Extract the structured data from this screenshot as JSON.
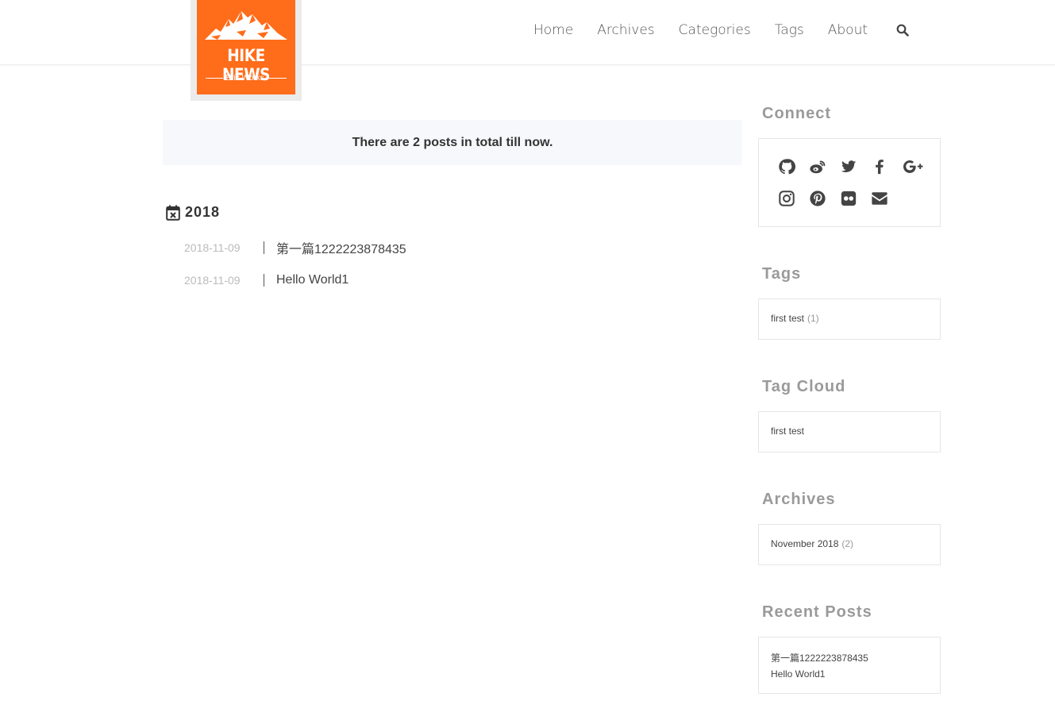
{
  "logo": {
    "title": "HIKE NEWS",
    "subtitle": "Eric Works."
  },
  "nav": {
    "items": [
      "Home",
      "Archives",
      "Categories",
      "Tags",
      "About"
    ],
    "search_icon": "search-icon"
  },
  "archive": {
    "summary": "There are 2 posts in total till now.",
    "year": "2018",
    "posts": [
      {
        "date": "2018-11-09",
        "title": "第一篇1222223878435"
      },
      {
        "date": "2018-11-09",
        "title": "Hello World1"
      }
    ]
  },
  "sidebar": {
    "connect": {
      "title": "Connect",
      "icons_row1": [
        "github-icon",
        "weibo-icon",
        "twitter-icon",
        "facebook-icon",
        "google-plus-icon"
      ],
      "icons_row2": [
        "instagram-icon",
        "pinterest-icon",
        "flickr-icon",
        "envelope-icon"
      ]
    },
    "tags": {
      "title": "Tags",
      "items": [
        {
          "name": "first test",
          "count": "(1)"
        }
      ]
    },
    "tag_cloud": {
      "title": "Tag Cloud",
      "items": [
        "first test"
      ]
    },
    "archives": {
      "title": "Archives",
      "items": [
        {
          "name": "November 2018",
          "count": "(2)"
        }
      ]
    },
    "recent_posts": {
      "title": "Recent Posts",
      "items": [
        "第一篇1222223878435",
        "Hello World1"
      ]
    }
  },
  "colors": {
    "brand_orange": "#ff6c1a",
    "summary_bg": "#f7f8fb",
    "widget_title": "#9a9a9a"
  }
}
